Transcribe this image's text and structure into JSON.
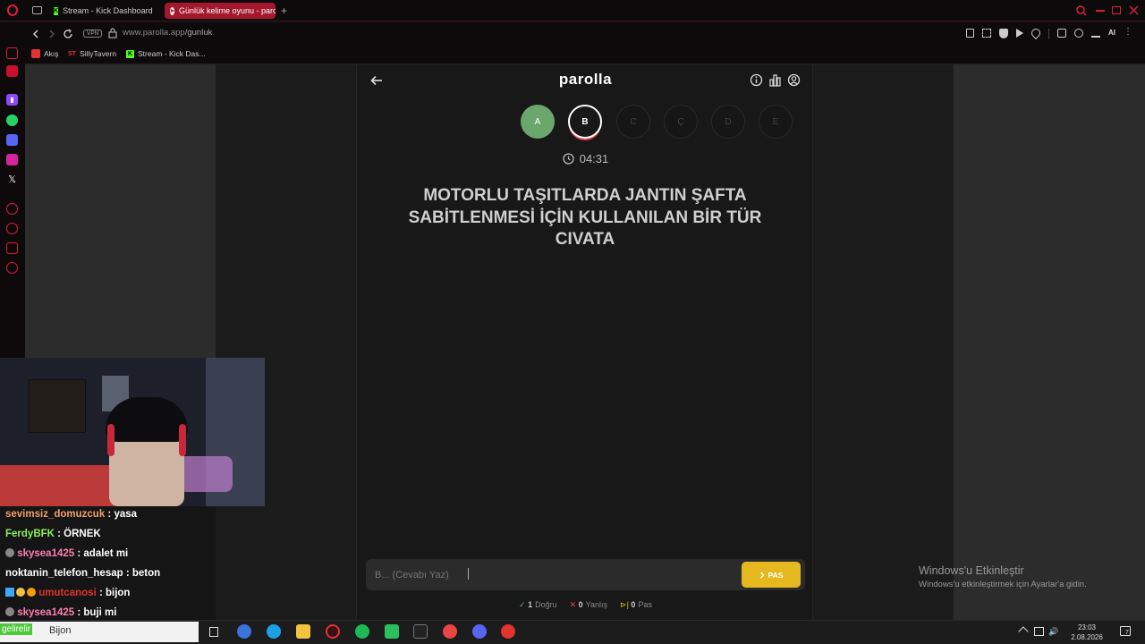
{
  "browser": {
    "tabs": [
      {
        "label": "Stream - Kick Dashboard",
        "active": false
      },
      {
        "label": "Günlük kelime oyunu - paro",
        "active": true
      }
    ],
    "new_tab_label": "+",
    "url_domain": "www.parolla.app",
    "url_path": "/gunluk",
    "vpn_label": "VPN",
    "bookmarks": [
      "Akış",
      "SillyTavern",
      "Stream - Kick Das..."
    ],
    "ai_label": "AI"
  },
  "app": {
    "logo": "parolla",
    "letters": [
      {
        "char": "A",
        "state": "done"
      },
      {
        "char": "B",
        "state": "current"
      },
      {
        "char": "C",
        "state": "todo"
      },
      {
        "char": "Ç",
        "state": "todo"
      },
      {
        "char": "D",
        "state": "todo"
      },
      {
        "char": "E",
        "state": "todo"
      }
    ],
    "timer": "04:31",
    "question": "MOTORLU TAŞITLARDA JANTIN ŞAFTA SABİTLENMESİ İÇİN KULLANILAN BİR TÜR CIVATA",
    "answer_placeholder": "B... (Cevabı Yaz)",
    "pass_label": "PAS",
    "stats": {
      "correct_count": "1",
      "correct_label": "Doğru",
      "wrong_count": "0",
      "wrong_label": "Yanlış",
      "pass_count": "0",
      "pass_label": "Pas"
    }
  },
  "chat": [
    {
      "user": "sevimsiz_domuzcuk",
      "color": "#f0a06a",
      "msg": ": yasa"
    },
    {
      "user": "FerdyBFK",
      "color": "#8ef05a",
      "msg": ": ÖRNEK"
    },
    {
      "user": "skysea1425",
      "color": "#ff7fb0",
      "msg": ": adalet mi"
    },
    {
      "user": "noktanin_telefon_hesap",
      "color": "#ffffff",
      "msg": ": beton"
    },
    {
      "user": "umutcanosi",
      "color": "#e0342f",
      "msg": ": bijon"
    },
    {
      "user": "skysea1425",
      "color": "#ff7fb0",
      "msg": ": buji mi"
    }
  ],
  "taskbar": {
    "search_prefix": "gelirelir",
    "search_text": "Bijon",
    "time": "23:03",
    "date": "2.08.2026",
    "notification_count": "7"
  },
  "windows_activate": {
    "title": "Windows'u Etkinleştir",
    "subtitle": "Windows'u etkinleştirmek için Ayarlar'a gidin."
  }
}
